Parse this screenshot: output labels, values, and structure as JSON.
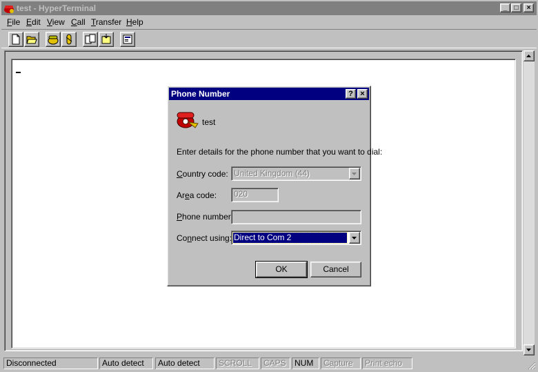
{
  "window": {
    "title": "test - HyperTerminal",
    "min_glyph": "_",
    "max_glyph": "□",
    "close_glyph": "×"
  },
  "menu": {
    "items": [
      {
        "label": "File",
        "key": "F",
        "rest": "ile"
      },
      {
        "label": "Edit",
        "key": "E",
        "rest": "dit"
      },
      {
        "label": "View",
        "key": "V",
        "rest": "iew"
      },
      {
        "label": "Call",
        "key": "C",
        "rest": "all"
      },
      {
        "label": "Transfer",
        "key": "T",
        "rest": "ransfer"
      },
      {
        "label": "Help",
        "key": "H",
        "rest": "elp"
      }
    ]
  },
  "toolbar": {
    "buttons": [
      "new-icon",
      "open-icon",
      "connect-icon",
      "disconnect-icon",
      "send-icon",
      "receive-icon",
      "properties-icon"
    ]
  },
  "dialog": {
    "title": "Phone Number",
    "help_glyph": "?",
    "close_glyph": "×",
    "connection_name": "test",
    "instructions": "Enter details for the phone number that you want to dial:",
    "country_label_pre": "",
    "country_label_key": "C",
    "country_label_post": "ountry code:",
    "country_value": "United Kingdom (44)",
    "area_label_pre": "Ar",
    "area_label_key": "e",
    "area_label_post": "a code:",
    "area_value": "020",
    "phone_label_pre": "",
    "phone_label_key": "P",
    "phone_label_post": "hone number:",
    "phone_value": "",
    "connect_label_pre": "Co",
    "connect_label_key": "n",
    "connect_label_post": "nect using:",
    "connect_value": "Direct to Com 2",
    "ok_label": "OK",
    "cancel_label": "Cancel"
  },
  "status": {
    "cells": [
      {
        "text": "Disconnected",
        "dim": false
      },
      {
        "text": "Auto detect",
        "dim": false
      },
      {
        "text": "Auto detect",
        "dim": false
      },
      {
        "text": "SCROLL",
        "dim": true
      },
      {
        "text": "CAPS",
        "dim": true
      },
      {
        "text": "NUM",
        "dim": false
      },
      {
        "text": "Capture",
        "dim": true
      },
      {
        "text": "Print echo",
        "dim": true
      }
    ]
  },
  "colors": {
    "inactive_title": "#808080",
    "active_title": "#000080",
    "face": "#c0c0c0"
  }
}
